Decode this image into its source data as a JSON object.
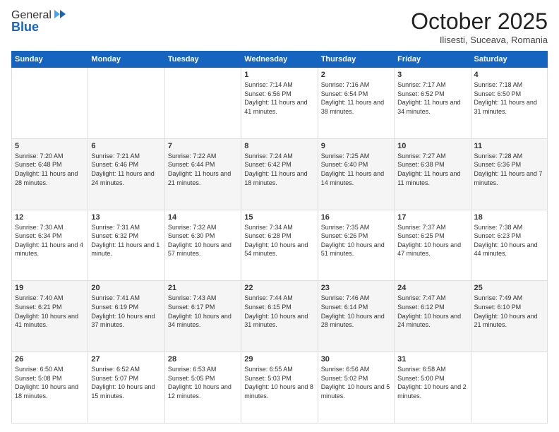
{
  "logo": {
    "general": "General",
    "blue": "Blue"
  },
  "header": {
    "title": "October 2025",
    "subtitle": "Ilisesti, Suceava, Romania"
  },
  "weekdays": [
    "Sunday",
    "Monday",
    "Tuesday",
    "Wednesday",
    "Thursday",
    "Friday",
    "Saturday"
  ],
  "weeks": [
    [
      {
        "day": "",
        "info": ""
      },
      {
        "day": "",
        "info": ""
      },
      {
        "day": "",
        "info": ""
      },
      {
        "day": "1",
        "info": "Sunrise: 7:14 AM\nSunset: 6:56 PM\nDaylight: 11 hours and 41 minutes."
      },
      {
        "day": "2",
        "info": "Sunrise: 7:16 AM\nSunset: 6:54 PM\nDaylight: 11 hours and 38 minutes."
      },
      {
        "day": "3",
        "info": "Sunrise: 7:17 AM\nSunset: 6:52 PM\nDaylight: 11 hours and 34 minutes."
      },
      {
        "day": "4",
        "info": "Sunrise: 7:18 AM\nSunset: 6:50 PM\nDaylight: 11 hours and 31 minutes."
      }
    ],
    [
      {
        "day": "5",
        "info": "Sunrise: 7:20 AM\nSunset: 6:48 PM\nDaylight: 11 hours and 28 minutes."
      },
      {
        "day": "6",
        "info": "Sunrise: 7:21 AM\nSunset: 6:46 PM\nDaylight: 11 hours and 24 minutes."
      },
      {
        "day": "7",
        "info": "Sunrise: 7:22 AM\nSunset: 6:44 PM\nDaylight: 11 hours and 21 minutes."
      },
      {
        "day": "8",
        "info": "Sunrise: 7:24 AM\nSunset: 6:42 PM\nDaylight: 11 hours and 18 minutes."
      },
      {
        "day": "9",
        "info": "Sunrise: 7:25 AM\nSunset: 6:40 PM\nDaylight: 11 hours and 14 minutes."
      },
      {
        "day": "10",
        "info": "Sunrise: 7:27 AM\nSunset: 6:38 PM\nDaylight: 11 hours and 11 minutes."
      },
      {
        "day": "11",
        "info": "Sunrise: 7:28 AM\nSunset: 6:36 PM\nDaylight: 11 hours and 7 minutes."
      }
    ],
    [
      {
        "day": "12",
        "info": "Sunrise: 7:30 AM\nSunset: 6:34 PM\nDaylight: 11 hours and 4 minutes."
      },
      {
        "day": "13",
        "info": "Sunrise: 7:31 AM\nSunset: 6:32 PM\nDaylight: 11 hours and 1 minute."
      },
      {
        "day": "14",
        "info": "Sunrise: 7:32 AM\nSunset: 6:30 PM\nDaylight: 10 hours and 57 minutes."
      },
      {
        "day": "15",
        "info": "Sunrise: 7:34 AM\nSunset: 6:28 PM\nDaylight: 10 hours and 54 minutes."
      },
      {
        "day": "16",
        "info": "Sunrise: 7:35 AM\nSunset: 6:26 PM\nDaylight: 10 hours and 51 minutes."
      },
      {
        "day": "17",
        "info": "Sunrise: 7:37 AM\nSunset: 6:25 PM\nDaylight: 10 hours and 47 minutes."
      },
      {
        "day": "18",
        "info": "Sunrise: 7:38 AM\nSunset: 6:23 PM\nDaylight: 10 hours and 44 minutes."
      }
    ],
    [
      {
        "day": "19",
        "info": "Sunrise: 7:40 AM\nSunset: 6:21 PM\nDaylight: 10 hours and 41 minutes."
      },
      {
        "day": "20",
        "info": "Sunrise: 7:41 AM\nSunset: 6:19 PM\nDaylight: 10 hours and 37 minutes."
      },
      {
        "day": "21",
        "info": "Sunrise: 7:43 AM\nSunset: 6:17 PM\nDaylight: 10 hours and 34 minutes."
      },
      {
        "day": "22",
        "info": "Sunrise: 7:44 AM\nSunset: 6:15 PM\nDaylight: 10 hours and 31 minutes."
      },
      {
        "day": "23",
        "info": "Sunrise: 7:46 AM\nSunset: 6:14 PM\nDaylight: 10 hours and 28 minutes."
      },
      {
        "day": "24",
        "info": "Sunrise: 7:47 AM\nSunset: 6:12 PM\nDaylight: 10 hours and 24 minutes."
      },
      {
        "day": "25",
        "info": "Sunrise: 7:49 AM\nSunset: 6:10 PM\nDaylight: 10 hours and 21 minutes."
      }
    ],
    [
      {
        "day": "26",
        "info": "Sunrise: 6:50 AM\nSunset: 5:08 PM\nDaylight: 10 hours and 18 minutes."
      },
      {
        "day": "27",
        "info": "Sunrise: 6:52 AM\nSunset: 5:07 PM\nDaylight: 10 hours and 15 minutes."
      },
      {
        "day": "28",
        "info": "Sunrise: 6:53 AM\nSunset: 5:05 PM\nDaylight: 10 hours and 12 minutes."
      },
      {
        "day": "29",
        "info": "Sunrise: 6:55 AM\nSunset: 5:03 PM\nDaylight: 10 hours and 8 minutes."
      },
      {
        "day": "30",
        "info": "Sunrise: 6:56 AM\nSunset: 5:02 PM\nDaylight: 10 hours and 5 minutes."
      },
      {
        "day": "31",
        "info": "Sunrise: 6:58 AM\nSunset: 5:00 PM\nDaylight: 10 hours and 2 minutes."
      },
      {
        "day": "",
        "info": ""
      }
    ]
  ]
}
